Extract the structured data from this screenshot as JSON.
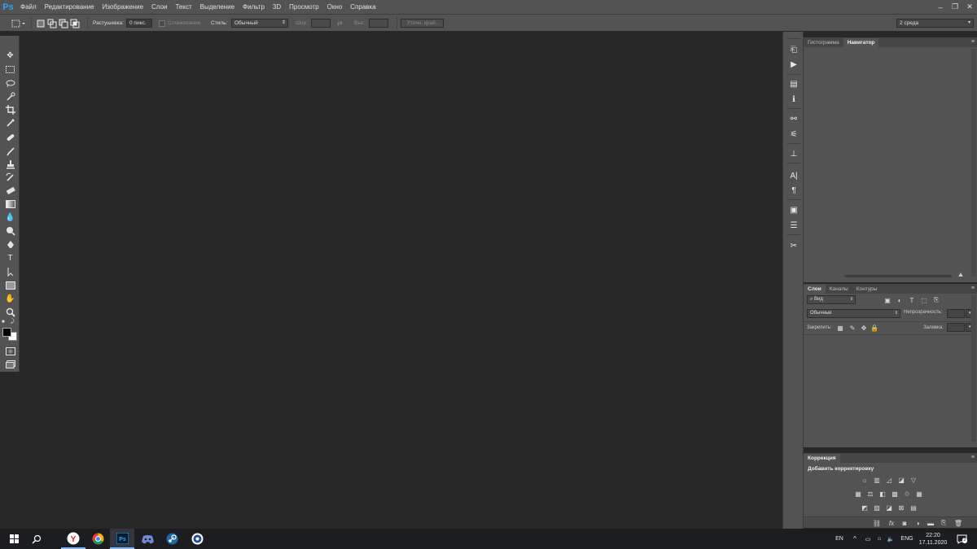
{
  "app": {
    "logo": "Ps"
  },
  "menu": [
    "Файл",
    "Редактирование",
    "Изображение",
    "Слои",
    "Текст",
    "Выделение",
    "Фильтр",
    "3D",
    "Просмотр",
    "Окно",
    "Справка"
  ],
  "window_controls": {
    "minimize": "–",
    "restore": "❐",
    "close": "✕"
  },
  "options": {
    "feather_label": "Растушевка:",
    "feather_value": "0 пикс.",
    "antialias_label": "Сглаживание",
    "style_label": "Стиль:",
    "style_value": "Обычный",
    "width_label": "Шир.:",
    "height_label": "Выс.:",
    "refine_label": "Уточн. край...",
    "workspace": "2 среда"
  },
  "panels": {
    "top_tabs": [
      "Гистограмма",
      "Навигатор"
    ],
    "layers_tabs": [
      "Слои",
      "Каналы",
      "Контуры"
    ],
    "layers_filter": "Вид",
    "blend_mode": "Обычные",
    "opacity_label": "Непрозрачность:",
    "lock_label": "Закрепить:",
    "fill_label": "Заливка:",
    "corrections_tab": "Коррекция",
    "corrections_add": "Добавить корректировку"
  },
  "taskbar": {
    "lang_short": "EN",
    "lang": "ENG",
    "time": "22:20",
    "date": "17.11.2020",
    "notification_count": "2"
  },
  "colors": {
    "ps_blue": "#2fa3f0",
    "panel": "#535353",
    "canvas": "#282828",
    "taskbar": "#1c1d20"
  }
}
